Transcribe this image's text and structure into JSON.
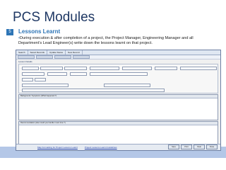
{
  "slide": {
    "title": "PCS Modules",
    "section_number": "5",
    "section_title": "Lessons Learnt",
    "bullet_text": "During execution & after completion of a project, the Project Manager, Engineering Manager and all Department’s Lead Engineer(s) write down the lessons learnt on that project."
  },
  "app": {
    "tabs": [
      "Search",
      "Saved Records",
      "Update Status",
      "New Record"
    ],
    "group_label": "Lesson Details",
    "panel1_title": "Background / Symptoms (What happened ?)",
    "panel2_title": "Recommendation (How could you handle it next time ?)",
    "footer_link": "Map Formatting for Project Lessons Learnt",
    "footer_link2": "Project Lessons Learnt Guidelines",
    "buttons": [
      "Save",
      "Print",
      "Clear",
      "Close"
    ]
  }
}
